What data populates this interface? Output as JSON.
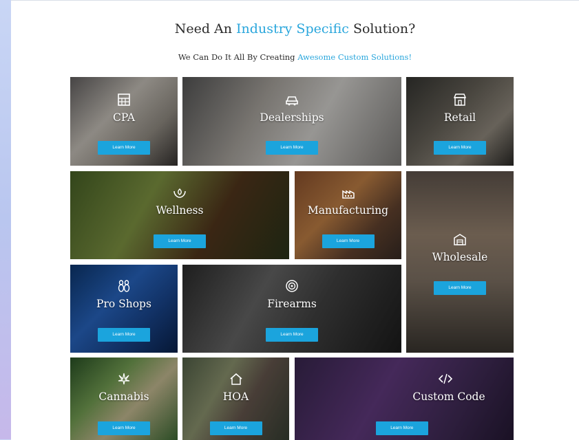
{
  "heading": {
    "prefix": "Need An",
    "highlight": "Industry Specific",
    "suffix": "Solution?"
  },
  "subheading": {
    "prefix": "We Can Do It All By Creating",
    "highlight": "Awesome Custom Solutions!"
  },
  "button_label": "Learn More",
  "colors": {
    "accent": "#29a6dc",
    "button": "#1ba4dd",
    "text": "#2b2b2b"
  },
  "tiles": [
    {
      "label": "CPA",
      "icon": "calculator-icon"
    },
    {
      "label": "Dealerships",
      "icon": "car-icon"
    },
    {
      "label": "Retail",
      "icon": "storefront-icon"
    },
    {
      "label": "Wellness",
      "icon": "hands-lotus-icon"
    },
    {
      "label": "Manufacturing",
      "icon": "factory-icon"
    },
    {
      "label": "Wholesale",
      "icon": "warehouse-icon"
    },
    {
      "label": "Pro Shops",
      "icon": "bowling-pins-icon"
    },
    {
      "label": "Firearms",
      "icon": "target-icon"
    },
    {
      "label": "Cannabis",
      "icon": "cannabis-leaf-icon"
    },
    {
      "label": "HOA",
      "icon": "house-icon"
    },
    {
      "label": "Custom Code",
      "icon": "code-brackets-icon"
    }
  ]
}
